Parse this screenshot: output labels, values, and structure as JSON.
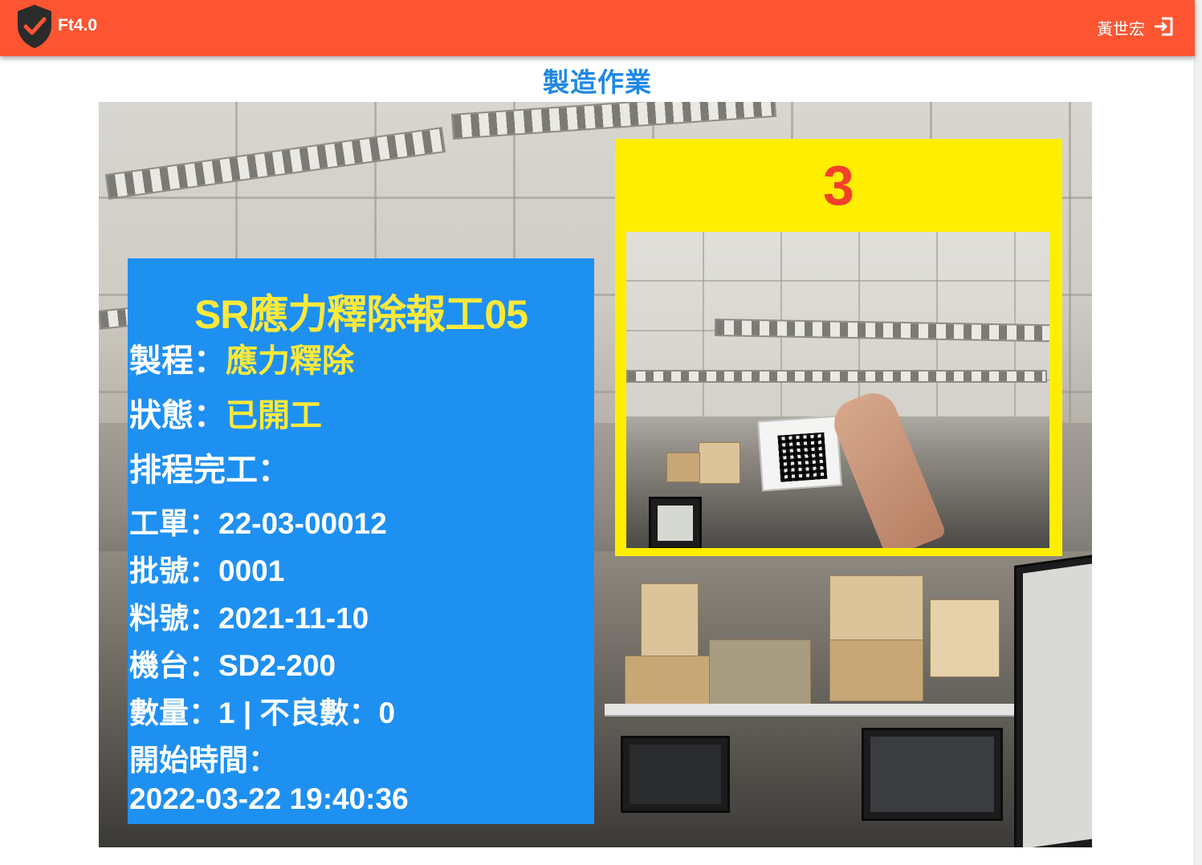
{
  "header": {
    "app_name": "Ft4.0",
    "user_name": "黃世宏",
    "logo_icon": "shield-check-icon",
    "logout_icon": "logout-icon",
    "accent_color": "#fd5532"
  },
  "page": {
    "title": "製造作業",
    "title_color": "#1e88e5"
  },
  "info_panel": {
    "title": "SR應力釋除報工05",
    "process_label": "製程：",
    "process_value": "應力釋除",
    "status_label": "狀態：",
    "status_value": "已開工",
    "schedule_label": "排程完工：",
    "work_order_label": "工單：",
    "work_order_value": "22-03-00012",
    "batch_label": "批號：",
    "batch_value": "0001",
    "part_label": "料號：",
    "part_value": "2021-11-10",
    "machine_label": "機台：",
    "machine_value": "SD2-200",
    "quantity_label": "數量：",
    "quantity_value": "1",
    "separator": " | ",
    "defect_label": "不良數：",
    "defect_value": "0",
    "start_time_label": "開始時間：",
    "start_time_value": "2022-03-22 19:40:36",
    "panel_color": "#1e90f2",
    "highlight_color": "#fde93a"
  },
  "qr_capture": {
    "countdown": "3",
    "frame_color": "#ffee00",
    "countdown_color": "#f2402a"
  }
}
